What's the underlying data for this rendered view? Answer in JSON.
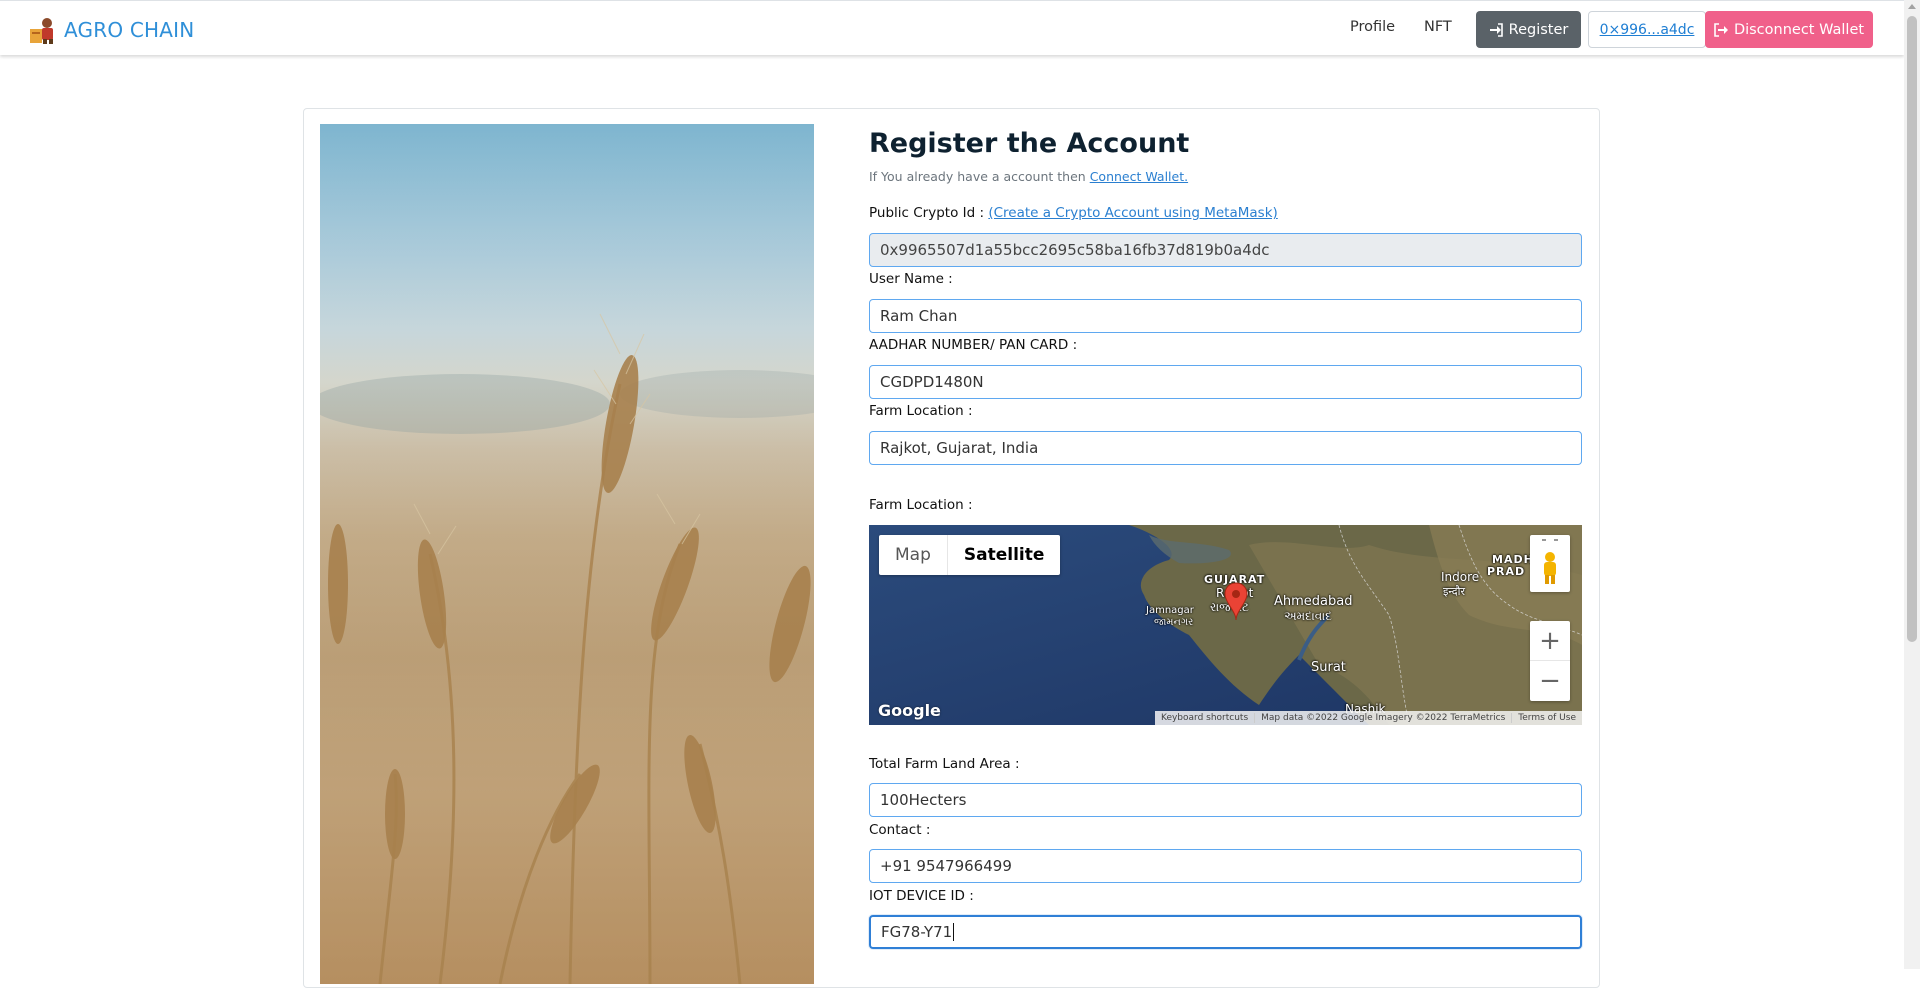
{
  "navbar": {
    "brand": "AGRO CHAIN",
    "links": [
      "Profile",
      "NFT"
    ],
    "register_label": "Register",
    "wallet_label": "0×996...a4dc",
    "disconnect_label": "Disconnect Wallet"
  },
  "form": {
    "title": "Register the Account",
    "subtitle_prefix": "If You already have a account then ",
    "subtitle_link": "Connect Wallet.",
    "public_crypto_label": "Public Crypto Id : ",
    "create_account_link": "(Create a Crypto Account using MetaMask)",
    "public_crypto_value": "0x9965507d1a55bcc2695c58ba16fb37d819b0a4dc",
    "username_label": "User Name :",
    "username_value": "Ram Chan",
    "aadhar_label": "AADHAR NUMBER/ PAN CARD :",
    "aadhar_value": "CGDPD1480N",
    "farm_location_label": "Farm Location :",
    "farm_location_value": "Rajkot, Gujarat, India",
    "map_label": "Farm Location :",
    "land_area_label": "Total Farm Land Area :",
    "land_area_value": "100Hecters",
    "contact_label": "Contact :",
    "contact_value": "+91 9547966499",
    "iot_label": "IOT DEVICE ID :",
    "iot_value": "FG78-Y71"
  },
  "map": {
    "type_map": "Map",
    "type_satellite": "Satellite",
    "selected_type": "Satellite",
    "google": "Google",
    "footer": [
      "Keyboard shortcuts",
      "Map data ©2022 Google Imagery ©2022 TerraMetrics",
      "Terms of Use"
    ],
    "places": {
      "gujarat": "GUJARAT",
      "rajkot": "Rajkot",
      "rajkot_local": "રાજકોટ",
      "jamnagar": "Jamnagar",
      "jamnagar_local": "જામનગર",
      "ahmedabad": "Ahmedabad",
      "ahmedabad_local": "અમદાવાદ",
      "indore": "Indore",
      "indore_local": "इन्दौर",
      "madhya": "MADH",
      "pradesh": "PRAD",
      "surat": "Surat",
      "nashik": "Nashik"
    }
  }
}
